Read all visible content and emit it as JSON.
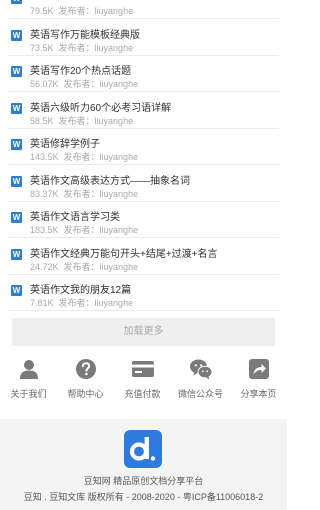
{
  "docs": [
    {
      "title": "",
      "size": "79.5K",
      "publisher_label": "发布者：",
      "publisher": "liuyanghe"
    },
    {
      "title": "英语写作万能模板经典版",
      "size": "73.5K",
      "publisher_label": "发布者：",
      "publisher": "liuyanghe"
    },
    {
      "title": "英语写作20个热点话题",
      "size": "56.07K",
      "publisher_label": "发布者：",
      "publisher": "liuyanghe"
    },
    {
      "title": "英语六级听力60个必考习语详解",
      "size": "58.5K",
      "publisher_label": "发布者：",
      "publisher": "liuyanghe"
    },
    {
      "title": "英语修辞学例子",
      "size": "143.5K",
      "publisher_label": "发布者：",
      "publisher": "liuyanghe"
    },
    {
      "title": "英语作文高级表达方式——抽象名词",
      "size": "83.37K",
      "publisher_label": "发布者：",
      "publisher": "liuyanghe"
    },
    {
      "title": "英语作文语言学习类",
      "size": "183.5K",
      "publisher_label": "发布者：",
      "publisher": "liuyanghe"
    },
    {
      "title": "英语作文经典万能句开头+结尾+过渡+名言",
      "size": "24.72K",
      "publisher_label": "发布者：",
      "publisher": "liuyanghe"
    },
    {
      "title": "英语作文我的朋友12篇",
      "size": "7.81K",
      "publisher_label": "发布者：",
      "publisher": "liuyanghe"
    }
  ],
  "doc_icon_letter": "W",
  "load_more": "加载更多",
  "nav": [
    {
      "label": "关于我们",
      "icon": "person-icon"
    },
    {
      "label": "帮助中心",
      "icon": "question-icon"
    },
    {
      "label": "充值付款",
      "icon": "card-icon"
    },
    {
      "label": "微信公众号",
      "icon": "wechat-icon"
    },
    {
      "label": "分享本页",
      "icon": "share-icon"
    }
  ],
  "footer": {
    "line1": "豆知网 精品原创文档分享平台",
    "line2": "豆知 . 豆知文库 版权所有 - 2008-2020 - 粤ICP备11006018-2"
  },
  "colors": {
    "brand": "#2d7be0",
    "doc_icon": "#2a7fd4",
    "nav_icon": "#7a7a7a"
  }
}
